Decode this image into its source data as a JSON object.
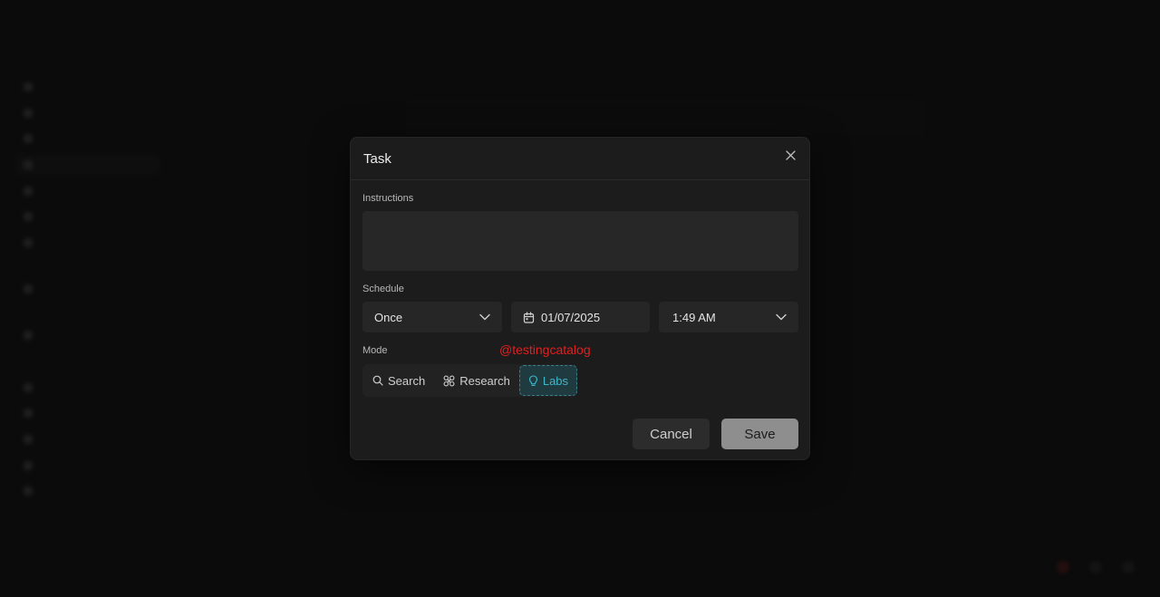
{
  "modal": {
    "title": "Task",
    "close_icon": "close-icon",
    "instructions_label": "Instructions",
    "instructions_value": "",
    "schedule_label": "Schedule",
    "frequency": "Once",
    "date": "01/07/2025",
    "time": "1:49 AM",
    "mode_label": "Mode",
    "modes": [
      {
        "label": "Search",
        "icon": "search-icon",
        "active": false
      },
      {
        "label": "Research",
        "icon": "research-icon",
        "active": false
      },
      {
        "label": "Labs",
        "icon": "lightbulb-icon",
        "active": true
      }
    ],
    "cancel_label": "Cancel",
    "save_label": "Save"
  },
  "watermark": "@testingcatalog",
  "colors": {
    "accent": "#3fb7c9",
    "watermark": "#e02020",
    "modal_bg": "#1c1c1c"
  }
}
